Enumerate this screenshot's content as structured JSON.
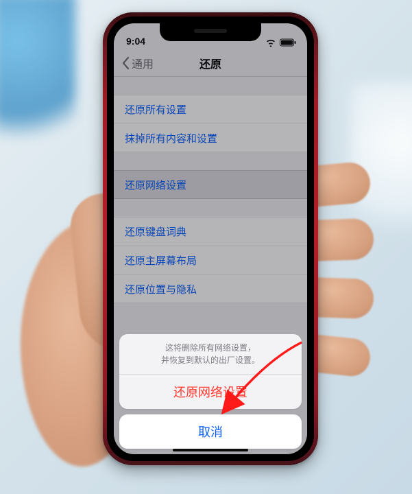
{
  "status": {
    "time": "9:04"
  },
  "nav": {
    "back_label": "通用",
    "title": "还原"
  },
  "sections": [
    {
      "rows": [
        {
          "label": "还原所有设置"
        },
        {
          "label": "抹掉所有内容和设置"
        }
      ]
    },
    {
      "rows": [
        {
          "label": "还原网络设置",
          "selected": true
        }
      ]
    },
    {
      "rows": [
        {
          "label": "还原键盘词典"
        },
        {
          "label": "还原主屏幕布局"
        },
        {
          "label": "还原位置与隐私"
        }
      ]
    }
  ],
  "sheet": {
    "message_line1": "这将删除所有网络设置，",
    "message_line2": "并恢复到默认的出厂设置。",
    "destructive_label": "还原网络设置",
    "cancel_label": "取消"
  },
  "colors": {
    "link": "#0a60ff",
    "destructive": "#ff3b30",
    "phone_red": "#b51e28"
  }
}
